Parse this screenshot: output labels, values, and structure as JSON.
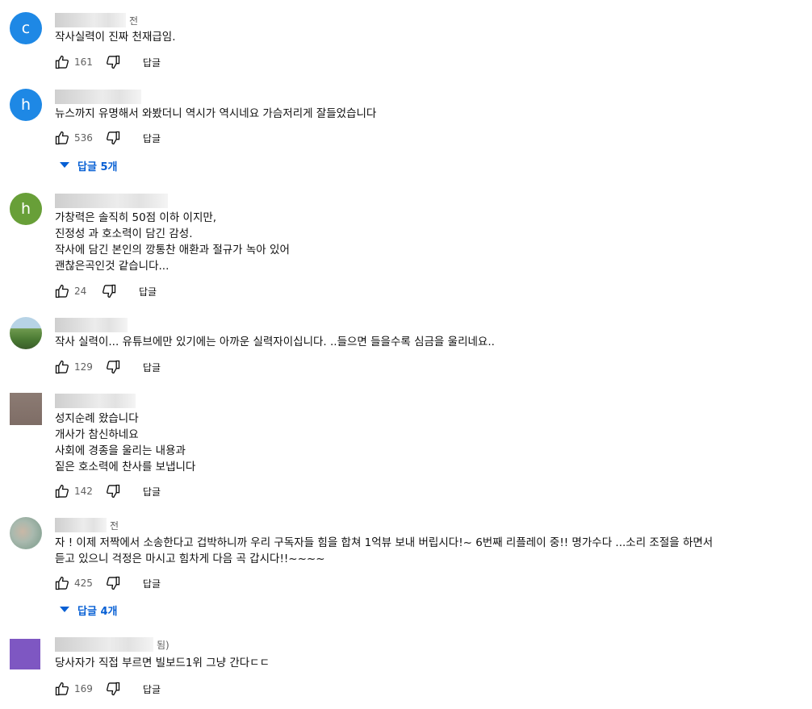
{
  "comments": [
    {
      "avatar_letter": "c",
      "avatar_color": "#1e88e5",
      "time": "전",
      "lines": [
        "작사실력이 진짜 천재급임."
      ],
      "likes": "161",
      "reply_label": "답글"
    },
    {
      "avatar_letter": "h",
      "avatar_color": "#1e88e5",
      "time": "",
      "lines": [
        "뉴스까지 유명해서 와봤더니 역시가 역시네요 가슴저리게 잘들었습니다"
      ],
      "likes": "536",
      "reply_label": "답글",
      "replies_label": "답글 5개"
    },
    {
      "avatar_letter": "h",
      "avatar_color": "#689f38",
      "time": "",
      "lines": [
        "가창력은 솔직히 50점 이하 이지만,",
        "진정성 과 호소력이 담긴 감성.",
        "작사에 담긴 본인의 깡통찬 애환과 절규가 녹아 있어",
        "괜찮은곡인것 같습니다..."
      ],
      "likes": "24",
      "reply_label": "답글"
    },
    {
      "avatar_letter": "",
      "avatar_color": "#4f7a3a",
      "time": "",
      "lines": [
        "작사 실력이... 유튜브에만 있기에는 아까운 실력자이십니다. ..들으면 들을수록 심금을 울리네요.."
      ],
      "likes": "129",
      "reply_label": "답글"
    },
    {
      "avatar_letter": "",
      "avatar_color": "#8a7a72",
      "time": "",
      "lines": [
        "성지순례 왔습니다",
        "개사가 참신하네요",
        "사회에 경종을 울리는 내용과",
        "짙은 호소력에 찬사를 보냅니다"
      ],
      "likes": "142",
      "reply_label": "답글"
    },
    {
      "avatar_letter": "",
      "avatar_color": "#9ab0a4",
      "time": "전",
      "lines": [
        "자 ! 이제 저짝에서 소송한다고 겁박하니까 우리 구독자들 힘을 합쳐 1억뷰 보내 버립시다!~  6번째 리플레이 중!! 명가수다 ...소리 조절을 하면서",
        "듣고 있으니 걱정은 마시고 힘차게 다음 곡 갑시다!!~~~~"
      ],
      "likes": "425",
      "reply_label": "답글",
      "replies_label": "답글 4개"
    },
    {
      "avatar_letter": "",
      "avatar_color": "#7e57c2",
      "time": "됨)",
      "lines": [
        "당사자가 직접 부르면 빌보드1위 그냥 간다ㄷㄷ"
      ],
      "likes": "169",
      "reply_label": "답글"
    }
  ]
}
